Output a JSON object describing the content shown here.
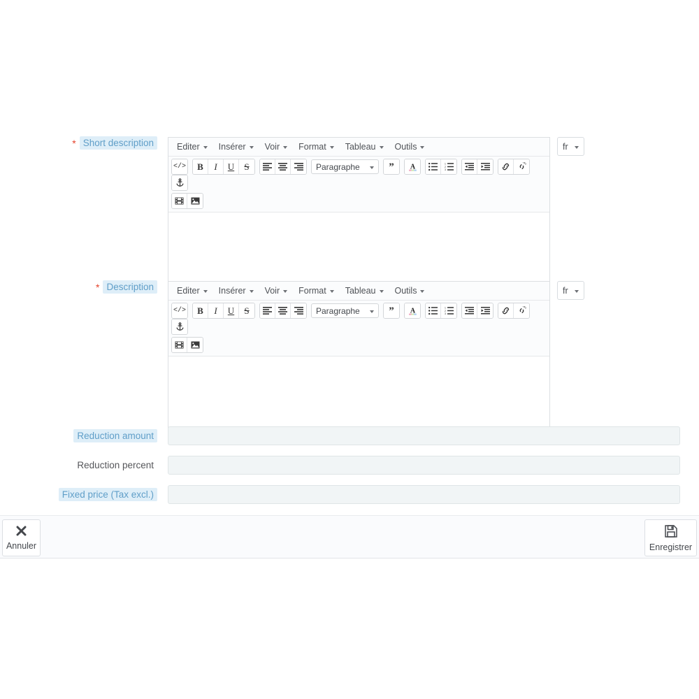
{
  "editor_menu": [
    {
      "label": "Editer"
    },
    {
      "label": "Insérer"
    },
    {
      "label": "Voir"
    },
    {
      "label": "Format"
    },
    {
      "label": "Tableau"
    },
    {
      "label": "Outils"
    }
  ],
  "toolbar": {
    "format_select": "Paragraphe",
    "row1_icons": [
      "source-code-icon",
      "bold-icon",
      "italic-icon",
      "underline-icon",
      "strikethrough-icon",
      "align-left-icon",
      "align-center-icon",
      "align-right-icon",
      "blockquote-icon",
      "text-color-icon",
      "bullet-list-icon",
      "numbered-list-icon",
      "outdent-icon",
      "indent-icon",
      "link-icon",
      "unlink-icon",
      "anchor-icon"
    ],
    "row2_icons": [
      "media-icon",
      "image-icon"
    ]
  },
  "language": {
    "code": "fr"
  },
  "fields": {
    "short_description": {
      "label": "Short description",
      "required": true,
      "value": ""
    },
    "description": {
      "label": "Description",
      "required": true,
      "value": ""
    },
    "reduction_amount": {
      "label": "Reduction amount",
      "highlighted": true,
      "value": "",
      "placeholder": ""
    },
    "reduction_percent": {
      "label": "Reduction percent",
      "highlighted": false,
      "value": "",
      "placeholder": ""
    },
    "fixed_price": {
      "label": "Fixed price (Tax excl.)",
      "highlighted": true,
      "value": "",
      "placeholder": ""
    }
  },
  "footer": {
    "cancel_label": "Annuler",
    "save_label": "Enregistrer"
  },
  "colors": {
    "label_accent": "#5f9ec8",
    "label_pill_bg": "#deeef8",
    "required_star": "#e5422b",
    "input_bg": "#f1f5f6",
    "footer_bg": "#fafbfd"
  }
}
